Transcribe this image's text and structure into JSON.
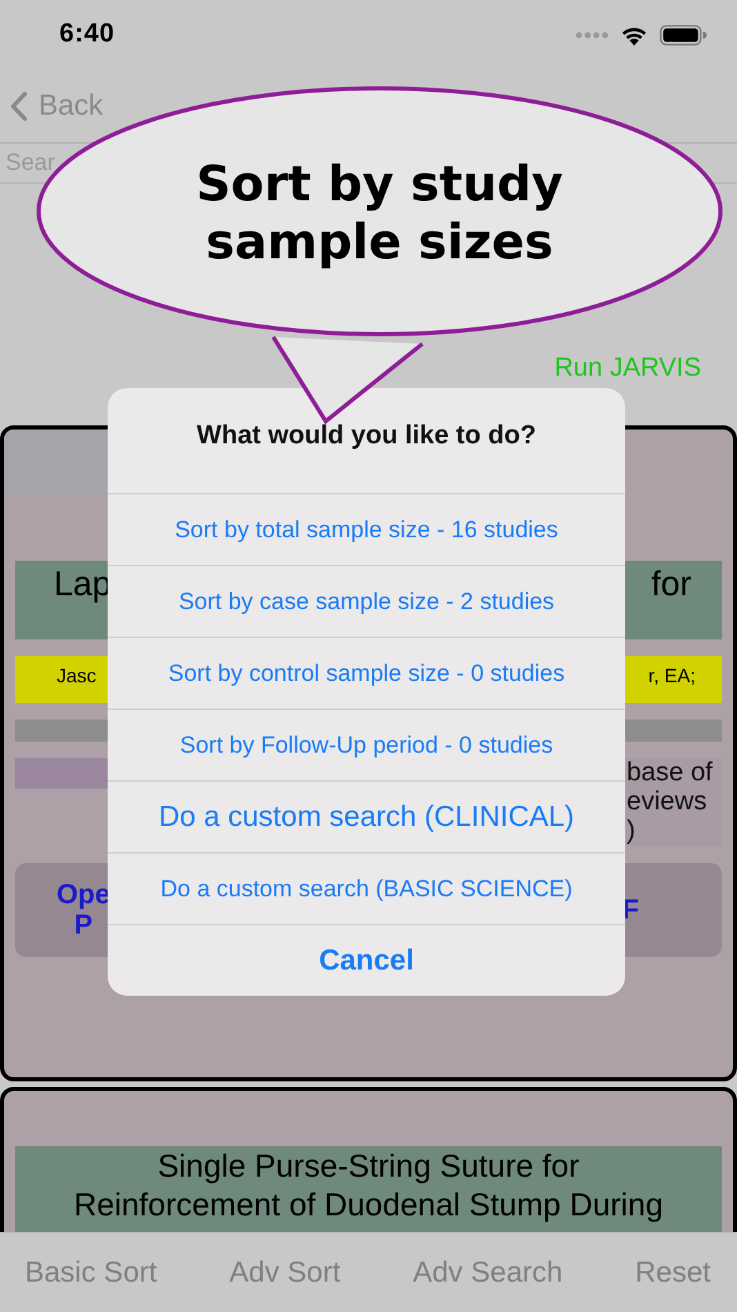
{
  "status_bar": {
    "time": "6:40"
  },
  "nav": {
    "back": "Back"
  },
  "search": {
    "placeholder": "Sear"
  },
  "run_link": "Run JARVIS",
  "cards": [
    {
      "title_left": "Lap",
      "title_right": "for",
      "authors_left": "Jasc",
      "authors_right": "r, EA;",
      "source_right": [
        "base of",
        "eviews",
        ")"
      ],
      "button_left": [
        "Ope",
        "P"
      ],
      "button_right": "F"
    },
    {
      "title": [
        "Single Purse-String Suture for",
        "Reinforcement of Duodenal Stump During"
      ]
    }
  ],
  "dialog": {
    "title": "What would you like to do?",
    "actions": [
      {
        "label": "Sort by total sample size - 16 studies",
        "kind": "default"
      },
      {
        "label": "Sort by case sample size - 2 studies",
        "kind": "default"
      },
      {
        "label": "Sort by control sample size - 0 studies",
        "kind": "default"
      },
      {
        "label": "Sort by Follow-Up period - 0 studies",
        "kind": "default"
      },
      {
        "label": "Do a custom search (CLINICAL)",
        "kind": "large"
      },
      {
        "label": "Do a custom search (BASIC SCIENCE)",
        "kind": "default"
      },
      {
        "label": "Cancel",
        "kind": "cancel"
      }
    ]
  },
  "callout": {
    "text": "Sort by study sample sizes"
  },
  "tab_bar": [
    "Basic Sort",
    "Adv Sort",
    "Adv Search",
    "Reset"
  ]
}
